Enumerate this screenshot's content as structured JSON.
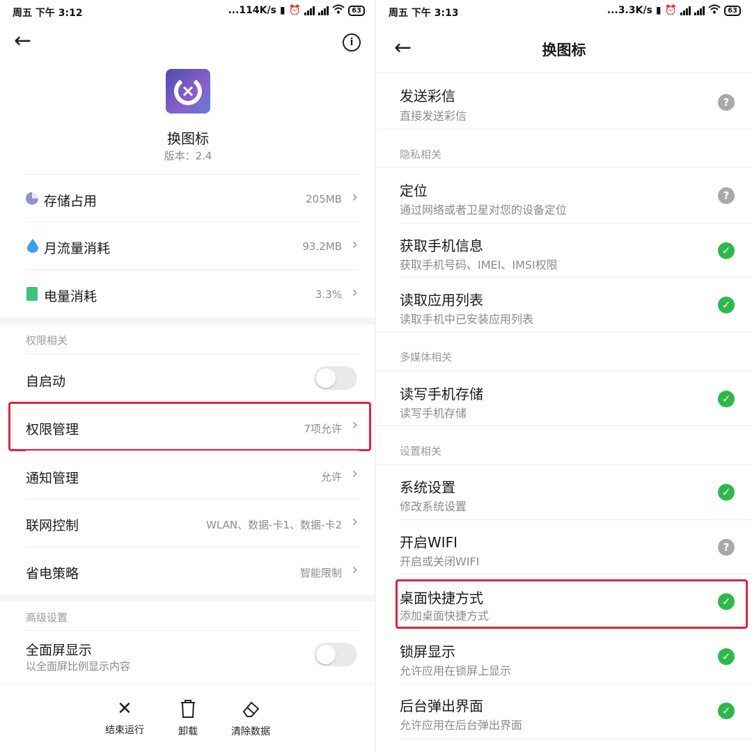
{
  "left": {
    "status": {
      "time": "周五 下午 3:12",
      "net": "...114K/s",
      "battery": "63"
    },
    "app": {
      "name": "换图标",
      "version": "版本：2.4"
    },
    "usage": [
      {
        "label": "存储占用",
        "value": "205MB"
      },
      {
        "label": "月流量消耗",
        "value": "93.2MB"
      },
      {
        "label": "电量消耗",
        "value": "3.3%"
      }
    ],
    "section_perm": "权限相关",
    "autostart": "自启动",
    "perm_manage": {
      "label": "权限管理",
      "value": "7项允许"
    },
    "notify": {
      "label": "通知管理",
      "value": "允许"
    },
    "network": {
      "label": "联网控制",
      "value": "WLAN、数据-卡1、数据-卡2"
    },
    "power": {
      "label": "省电策略",
      "value": "智能限制"
    },
    "section_adv": "高级设置",
    "fullscreen": {
      "label": "全面屏显示",
      "sub": "以全面屏比例显示内容"
    },
    "bottom": {
      "stop": "结束运行",
      "uninstall": "卸载",
      "clear": "清除数据"
    },
    "colors": {
      "highlight": "#e0213e"
    }
  },
  "right": {
    "status": {
      "time": "周五 下午 3:13",
      "net": "...3.3K/s",
      "battery": "63"
    },
    "title": "换图标",
    "sections": {
      "privacy": "隐私相关",
      "media": "多媒体相关",
      "settings": "设置相关"
    },
    "items": [
      {
        "title": "发送彩信",
        "sub": "直接发送彩信",
        "state": "ask"
      },
      {
        "title": "定位",
        "sub": "通过网络或者卫星对您的设备定位",
        "state": "ask"
      },
      {
        "title": "获取手机信息",
        "sub": "获取手机号码、IMEI、IMSI权限",
        "state": "ok"
      },
      {
        "title": "读取应用列表",
        "sub": "读取手机中已安装应用列表",
        "state": "ok"
      },
      {
        "title": "读写手机存储",
        "sub": "读写手机存储",
        "state": "ok"
      },
      {
        "title": "系统设置",
        "sub": "修改系统设置",
        "state": "ok"
      },
      {
        "title": "开启WIFI",
        "sub": "开启或关闭WIFI",
        "state": "ask"
      },
      {
        "title": "桌面快捷方式",
        "sub": "添加桌面快捷方式",
        "state": "ok"
      },
      {
        "title": "锁屏显示",
        "sub": "允许应用在锁屏上显示",
        "state": "ok"
      },
      {
        "title": "后台弹出界面",
        "sub": "允许应用在后台弹出界面",
        "state": "ok"
      }
    ]
  }
}
